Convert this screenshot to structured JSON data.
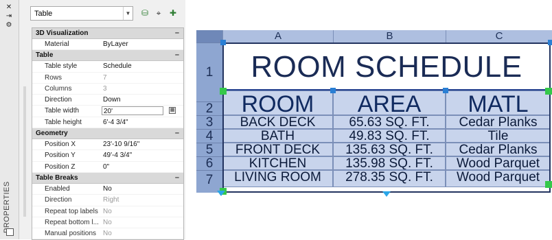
{
  "palette": {
    "title": "PROPERTIES",
    "selector_value": "Table",
    "strip_icons": [
      "close-icon",
      "auto-hide-icon",
      "options-icon"
    ],
    "toolbar_icons": [
      "quick-select-icon",
      "select-objects-icon",
      "toggle-pickadd-icon"
    ]
  },
  "categories": [
    {
      "name": "3D Visualization",
      "collapse": "–",
      "rows": [
        {
          "key": "Material",
          "value": "ByLayer",
          "readonly": false
        }
      ]
    },
    {
      "name": "Table",
      "collapse": "–",
      "rows": [
        {
          "key": "Table style",
          "value": "Schedule",
          "readonly": false
        },
        {
          "key": "Rows",
          "value": "7",
          "readonly": true
        },
        {
          "key": "Columns",
          "value": "3",
          "readonly": true
        },
        {
          "key": "Direction",
          "value": "Down",
          "readonly": false
        },
        {
          "key": "Table width",
          "value": "20'",
          "readonly": false,
          "editing": true
        },
        {
          "key": "Table height",
          "value": "6'-4 3/4\"",
          "readonly": false
        }
      ]
    },
    {
      "name": "Geometry",
      "collapse": "–",
      "rows": [
        {
          "key": "Position X",
          "value": "23'-10 9/16\"",
          "readonly": false
        },
        {
          "key": "Position Y",
          "value": "49'-4 3/4\"",
          "readonly": false
        },
        {
          "key": "Position Z",
          "value": "0\"",
          "readonly": false
        }
      ]
    },
    {
      "name": "Table Breaks",
      "collapse": "–",
      "rows": [
        {
          "key": "Enabled",
          "value": "No",
          "readonly": false
        },
        {
          "key": "Direction",
          "value": "Right",
          "readonly": true
        },
        {
          "key": "Repeat top labels",
          "value": "No",
          "readonly": true
        },
        {
          "key": "Repeat bottom l...",
          "value": "No",
          "readonly": true
        },
        {
          "key": "Manual positions",
          "value": "No",
          "readonly": true
        }
      ]
    }
  ],
  "table": {
    "column_headers": [
      "A",
      "B",
      "C"
    ],
    "row_headers": [
      "1",
      "2",
      "3",
      "4",
      "5",
      "6",
      "7"
    ],
    "title": "ROOM SCHEDULE",
    "headings": [
      "ROOM",
      "AREA",
      "MATL"
    ],
    "rows": [
      [
        "BACK DECK",
        "65.63 SQ. FT.",
        "Cedar Planks"
      ],
      [
        "BATH",
        "49.83 SQ. FT.",
        "Tile"
      ],
      [
        "FRONT DECK",
        "135.63 SQ. FT.",
        "Cedar Planks"
      ],
      [
        "KITCHEN",
        "135.98 SQ. FT.",
        "Wood Parquet"
      ],
      [
        "LIVING ROOM",
        "278.35 SQ. FT.",
        "Wood Parquet"
      ]
    ]
  },
  "colors": {
    "header_fill": "#aebfe0",
    "cell_fill": "#c8d4ec",
    "grip_blue": "#2a7fd4",
    "grip_green": "#34c84a",
    "outline": "#22335f"
  }
}
